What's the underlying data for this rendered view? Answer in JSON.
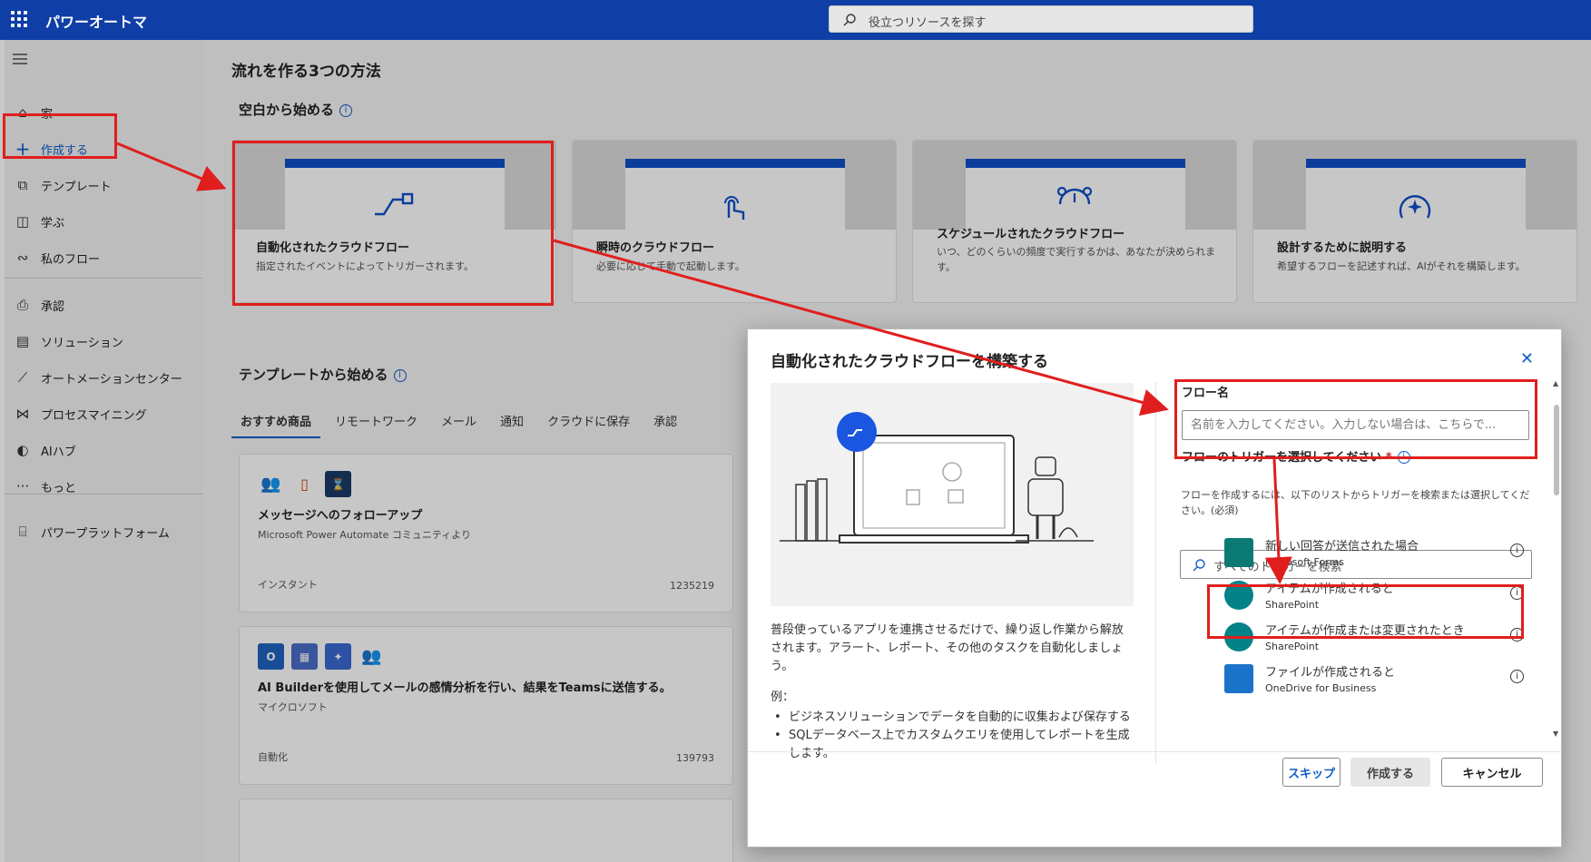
{
  "topbar": {
    "app_title": "パワーオートマ",
    "search_placeholder": "役立つリソースを探す"
  },
  "sidebar": {
    "items": [
      {
        "label": "家",
        "icon": "home-icon"
      },
      {
        "label": "作成する",
        "icon": "plus-icon",
        "active": true
      },
      {
        "label": "テンプレート",
        "icon": "template-icon"
      },
      {
        "label": "学ぶ",
        "icon": "book-icon"
      },
      {
        "label": "私のフロー",
        "icon": "flow-icon"
      },
      {
        "label": "承認",
        "icon": "approval-icon"
      },
      {
        "label": "ソリューション",
        "icon": "solution-icon"
      },
      {
        "label": "オートメーションセンター",
        "icon": "chart-icon"
      },
      {
        "label": "プロセスマイニング",
        "icon": "process-mining-icon"
      },
      {
        "label": "AIハブ",
        "icon": "ai-hub-icon"
      },
      {
        "label": "もっと",
        "icon": "more-icon"
      },
      {
        "label": "パワープラットフォーム",
        "icon": "power-platform-icon"
      }
    ]
  },
  "main": {
    "title": "流れを作る3つの方法",
    "blank_section": "空白から始める",
    "cards": [
      {
        "title": "自動化されたクラウドフロー",
        "desc": "指定されたイベントによってトリガーされます。"
      },
      {
        "title": "瞬時のクラウドフロー",
        "desc": "必要に応じて手動で起動します。"
      },
      {
        "title": "スケジュールされたクラウドフロー",
        "desc": "いつ、どのくらいの頻度で実行するかは、あなたが決められます。"
      },
      {
        "title": "設計するために説明する",
        "desc": "希望するフローを記述すれば、AIがそれを構築します。"
      }
    ],
    "template_section": "テンプレートから始める",
    "tabs": [
      "おすすめ商品",
      "リモートワーク",
      "メール",
      "通知",
      "クラウドに保存",
      "承認"
    ],
    "templates": [
      {
        "title": "メッセージへのフォローアップ",
        "source": "Microsoft Power Automate コミュニティより",
        "kind": "インスタント",
        "count": "1235219"
      },
      {
        "title": "AI Builderを使用してメールの感情分析を行い、結果をTeamsに送信する。",
        "source": "マイクロソフト",
        "kind": "自動化",
        "count": "139793"
      }
    ]
  },
  "dialog": {
    "title": "自動化されたクラウドフローを構築する",
    "description": "普段使っているアプリを連携させるだけで、繰り返し作業から解放されます。アラート、レポート、その他のタスクを自動化しましょう。",
    "example_label": "例：",
    "examples": [
      "ビジネスソリューションでデータを自動的に収集および保存する",
      "SQLデータベース上でカスタムクエリを使用してレポートを生成します。"
    ],
    "flow_name_label": "フロー名",
    "flow_name_placeholder": "名前を入力してください。入力しない場合は、こちらで...",
    "trigger_label": "フローのトリガーを選択してください",
    "required_mark": "*",
    "trigger_help": "フローを作成するには、以下のリストからトリガーを検索または選択してください。(必須)",
    "trigger_search_placeholder": "すべてのトリガーを検索",
    "triggers": [
      {
        "name": "新しい回答が送信された場合",
        "source": "Microsoft Forms",
        "color": "#0b7a75"
      },
      {
        "name": "アイテムが作成されると",
        "source": "SharePoint",
        "color": "#038387"
      },
      {
        "name": "アイテムが作成または変更されたとき",
        "source": "SharePoint",
        "color": "#038387"
      },
      {
        "name": "ファイルが作成されると",
        "source": "OneDrive for Business",
        "color": "#1a73c9"
      }
    ],
    "buttons": {
      "skip": "スキップ",
      "create": "作成する",
      "cancel": "キャンセル"
    }
  },
  "colors": {
    "accent": "#0f3fa6",
    "annotation": "#e01e1e"
  }
}
